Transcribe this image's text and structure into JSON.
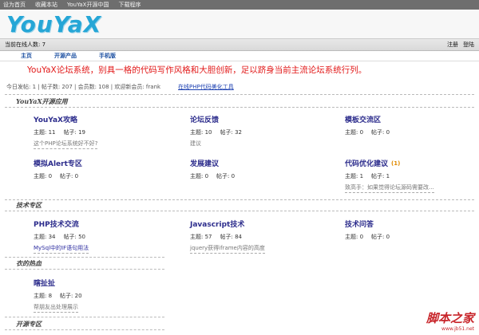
{
  "topbar": {
    "items": [
      "设为首页",
      "收藏本站",
      "YouYaX开源中国",
      "下载程序"
    ]
  },
  "brand": {
    "logo_text": "YouYaX"
  },
  "online_bar": {
    "text": "当前在线人数: 7",
    "login": "注册",
    "logout": "登陆"
  },
  "nav": [
    "主页",
    "开源产品",
    "手机版"
  ],
  "slogan": "YouYaX论坛系统，别具一格的代码写作风格和大胆创新，足以跻身当前主流论坛系统行列。",
  "stats": {
    "text": "今日发帖: 1 | 帖子数: 207 | 会员数: 108 | 欢迎新会员: frank",
    "link": "在线PHP代码美化工具"
  },
  "sections": [
    {
      "title": "YouYaX开源应用",
      "forums": [
        {
          "name": "YouYaX攻略",
          "topics": "主题: 11",
          "posts": "帖子: 19",
          "last": "这个PHP论坛系统好不好?"
        },
        {
          "name": "论坛反馈",
          "topics": "主题: 10",
          "posts": "帖子: 32",
          "last": "建议"
        },
        {
          "name": "模板交流区",
          "topics": "主题: 0",
          "posts": "帖子: 0",
          "last": ""
        },
        {
          "name": "模拟Alert专区",
          "topics": "主题: 0",
          "posts": "帖子: 0",
          "last": ""
        },
        {
          "name": "发展建议",
          "topics": "主题: 0",
          "posts": "帖子: 0",
          "last": ""
        },
        {
          "name": "代码优化建议",
          "badge": "(1)",
          "topics": "主题: 1",
          "posts": "帖子: 1",
          "last": "致高手：如果觉得论坛源码需要改..."
        }
      ]
    },
    {
      "title": "技术专区",
      "forums": [
        {
          "name": "PHP技术交流",
          "topics": "主题: 34",
          "posts": "帖子: 50",
          "last": "MySql中的IF语句用法"
        },
        {
          "name": "Javascript技术",
          "topics": "主题: 57",
          "posts": "帖子: 84",
          "last": "jquery获得iframe内容的高度"
        },
        {
          "name": "技术问答",
          "topics": "主题: 0",
          "posts": "帖子: 0",
          "last": ""
        }
      ]
    },
    {
      "title": "衣的热血",
      "forums": [
        {
          "name": "瞎扯扯",
          "topics": "主题: 8",
          "posts": "帖子: 20",
          "last": "帮朋友出处理展示"
        }
      ]
    },
    {
      "title": "开源专区"
    }
  ],
  "watermark": {
    "line1": "脚本之家",
    "line2": "www.jb51.net"
  },
  "colors": {
    "logo": "#25a6d6",
    "slogan": "#e21a1a",
    "forum_name": "#2c2c8c",
    "nav": "#1b4fa1"
  }
}
